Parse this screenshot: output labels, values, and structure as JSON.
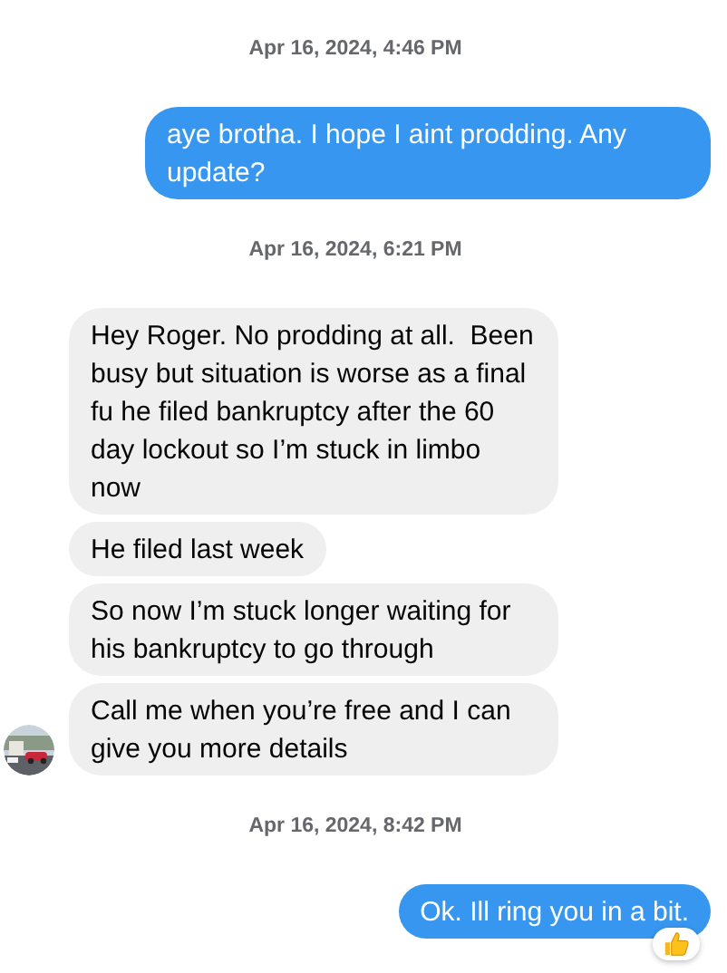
{
  "messages": [
    {
      "kind": "timestamp",
      "text": "Apr 16, 2024, 4:46 PM"
    },
    {
      "kind": "sent",
      "text": "aye brotha. I hope I aint prodding. Any update?"
    },
    {
      "kind": "timestamp",
      "text": "Apr 16, 2024, 6:21 PM"
    },
    {
      "kind": "received",
      "text": "Hey Roger. No prodding at all.  Been busy but situation is worse as a final fu he filed bankruptcy after the 60 day lockout so I’m stuck in limbo now"
    },
    {
      "kind": "received",
      "text": "He filed last week"
    },
    {
      "kind": "received",
      "text": "So now I’m stuck longer waiting for his bankruptcy to go through"
    },
    {
      "kind": "received",
      "text": "Call me when you’re free and I can give you more details",
      "avatar": true
    },
    {
      "kind": "timestamp",
      "text": "Apr 16, 2024, 8:42 PM"
    },
    {
      "kind": "sent",
      "text": "Ok. Ill ring you in a bit.",
      "reacted": true
    }
  ]
}
